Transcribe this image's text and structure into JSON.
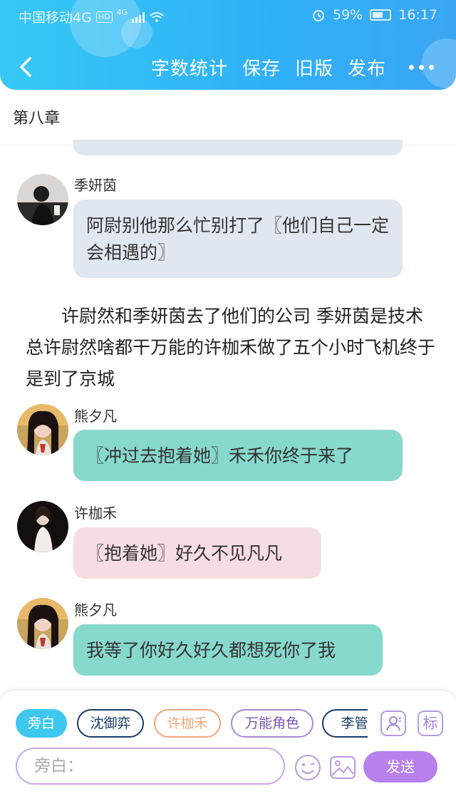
{
  "status_bar": {
    "carrier": "中国移动4G",
    "hd": "HD",
    "net": "4G",
    "battery": "59%",
    "time": "16:17"
  },
  "nav": {
    "word_count": "字数统计",
    "save": "保存",
    "old_version": "旧版",
    "publish": "发布"
  },
  "chapter": {
    "title": "第八章"
  },
  "messages": [
    {
      "speaker": "季妍茵",
      "text": "阿尉别他那么忙别打了〖他们自己一定会相遇的〗"
    },
    {
      "speaker": "熊夕凡",
      "text": "〖冲过去抱着她〗禾禾你终于来了"
    },
    {
      "speaker": "许枷禾",
      "text": "〖抱着她〗好久不见凡凡"
    },
    {
      "speaker": "熊夕凡",
      "text": "我等了你好久好久都想死你了我"
    }
  ],
  "narration": "许尉然和季妍茵去了他们的公司 季妍茵是技术总许尉然啥都干万能的许枷禾做了五个小时飞机终于是到了京城",
  "input_panel": {
    "roles": [
      "旁白",
      "沈御弈",
      "许枷禾",
      "万能角色",
      "李管家"
    ],
    "tag_button": "标",
    "input_placeholder": "旁白：",
    "input_value": "",
    "send": "发送"
  },
  "colors": {
    "header": "#2fb0f6",
    "bubble_gray": "#e1e7ef",
    "bubble_teal": "#87d8cd",
    "bubble_pink": "#f6dde1",
    "send": "#b880ec"
  }
}
